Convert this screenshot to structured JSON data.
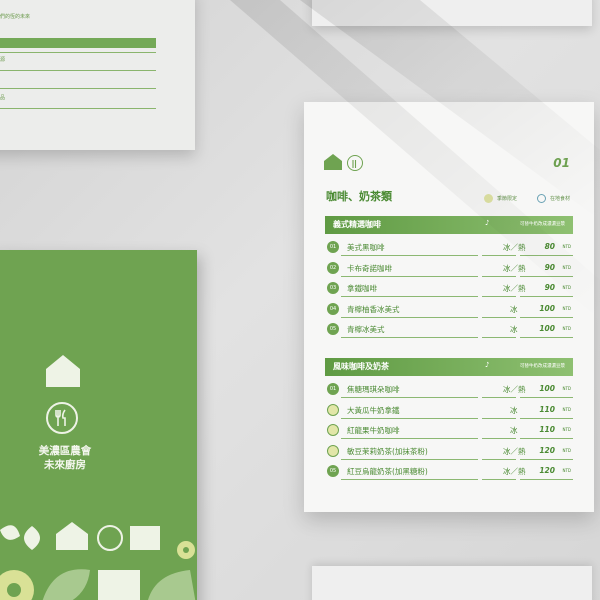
{
  "top_card": {
    "header_text": "們的恆的未來",
    "item_1": "源",
    "item_2": "品"
  },
  "cover": {
    "brand_line1": "美濃區農會",
    "brand_line2": "未來廚房"
  },
  "menu": {
    "page_number": "01",
    "category_title": "咖啡、奶茶類",
    "legend_seasonal": "季節限定",
    "legend_local": "在地食材",
    "sections": [
      {
        "title": "義式精選咖啡",
        "mark": "♪",
        "note": "可替牛奶改成濃濃豆漿",
        "items": [
          {
            "no": "01",
            "name": "美式黑咖啡",
            "temp": "冰／熱",
            "price": "80",
            "unit": "NTD",
            "seasonal": false
          },
          {
            "no": "02",
            "name": "卡布奇諾咖啡",
            "temp": "冰／熱",
            "price": "90",
            "unit": "NTD",
            "seasonal": false
          },
          {
            "no": "03",
            "name": "拿鐵咖啡",
            "temp": "冰／熱",
            "price": "90",
            "unit": "NTD",
            "seasonal": false
          },
          {
            "no": "04",
            "name": "青檸柚香冰美式",
            "temp": "冰",
            "price": "100",
            "unit": "NTD",
            "seasonal": false
          },
          {
            "no": "05",
            "name": "青檸冰美式",
            "temp": "冰",
            "price": "100",
            "unit": "NTD",
            "seasonal": false
          }
        ]
      },
      {
        "title": "風味咖啡及奶茶",
        "mark": "♪",
        "note": "可替牛奶改成濃濃豆漿",
        "items": [
          {
            "no": "01",
            "name": "焦糖瑪琪朵咖啡",
            "temp": "冰／熱",
            "price": "100",
            "unit": "NTD",
            "seasonal": false
          },
          {
            "no": "",
            "name": "大黃瓜牛奶拿鐵",
            "temp": "冰",
            "price": "110",
            "unit": "NTD",
            "seasonal": true
          },
          {
            "no": "",
            "name": "紅龍果牛奶咖啡",
            "temp": "冰",
            "price": "110",
            "unit": "NTD",
            "seasonal": true
          },
          {
            "no": "",
            "name": "敏豆茉莉奶茶(加抹茶粉)",
            "temp": "冰／熱",
            "price": "120",
            "unit": "NTD",
            "seasonal": true
          },
          {
            "no": "05",
            "name": "紅豆烏龍奶茶(加黑糖粉)",
            "temp": "冰／熱",
            "price": "120",
            "unit": "NTD",
            "seasonal": false
          }
        ]
      }
    ]
  },
  "colors": {
    "brand_green": "#6fa351",
    "seasonal_yellow": "#e2e6a8",
    "local_blue": "#6aa2b4"
  },
  "icons": [
    "house-icon",
    "fork-knife-icon"
  ]
}
